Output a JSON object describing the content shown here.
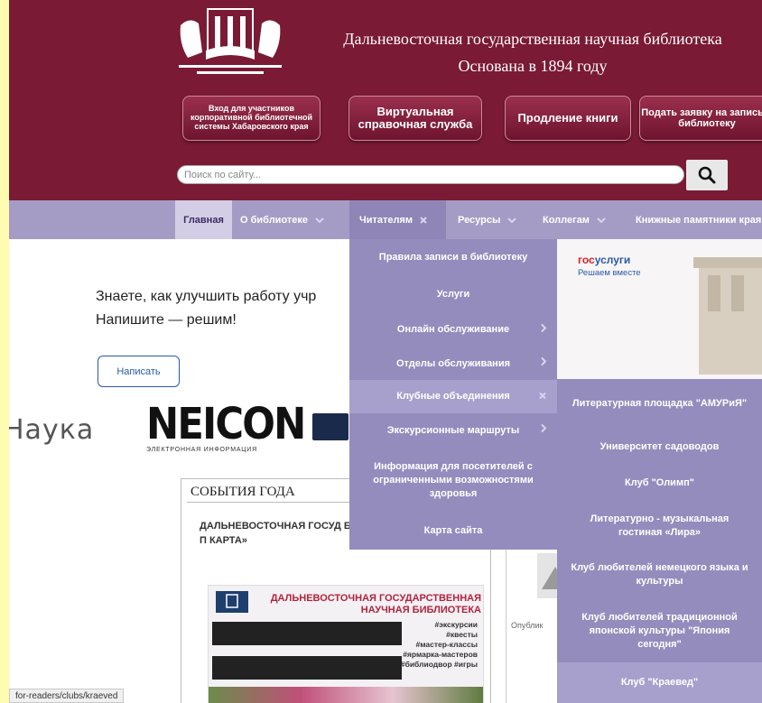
{
  "header": {
    "title_line1": "Дальневосточная государственная научная библиотека",
    "title_line2": "Основана в 1894 году",
    "buttons": {
      "members": "Вход для участников корпоративной библиотечной системы Хабаровского края",
      "virtual": "Виртуальная справочная служба",
      "renew": "Продление книги",
      "apply": "Подать заявку на запись в библиотеку"
    },
    "search_placeholder": "Поиск по сайту..."
  },
  "nav": {
    "items": [
      "Главная",
      "О библиотеке",
      "Читателям",
      "Ресурсы",
      "Коллегам",
      "Книжные памятники края"
    ]
  },
  "readers_menu": {
    "items": [
      "Правила записи в библиотеку",
      "Услуги",
      "Онлайн обслуживание",
      "Отделы обслуживания",
      "Клубные объединения",
      "Экскурсионные маршруты",
      "Информация для посетителей с ограниченными возможностями здоровья",
      "Карта сайта"
    ]
  },
  "club_submenu": {
    "items": [
      "Литературная площадка \"АМУРиЯ\"",
      "Университет садоводов",
      "Клуб \"Олимп\"",
      "Литературно - музыкальная гостиная «Лира»",
      "Клуб любителей немецкого языка и культуры",
      "Клуб любителей традиционной японской культуры \"Япония сегодня\"",
      "Клуб \"Краевед\""
    ]
  },
  "main": {
    "feedback_line1": "Знаете, как улучшить работу учр",
    "feedback_line2": "Напишите — решим!",
    "write_button": "Написать",
    "gos_logo_a": "гос",
    "gos_logo_b": "услуги",
    "gos_slogan": "Решаем вместе",
    "nauka": "Наука",
    "neicon": "NEICON",
    "neicon_sub": "ЭЛЕКТРОННАЯ ИНФОРМАЦИЯ",
    "events_title": "СОБЫТИЯ ГОДА",
    "events_text": "ДАЛЬНЕВОСТОЧНАЯ ГОСУД БИБЛИОТЕКА - УЧАСТНИК П КАРТА»",
    "banner_title": "ДАЛЬНЕВОСТОЧНАЯ ГОСУДАРСТВЕННАЯ НАУЧНАЯ БИБЛИОТЕКА",
    "banner_tags": [
      "#экскурсии",
      "#квесты",
      "#мастер-классы",
      "#ярмарка-мастеров",
      "#библиодвор #игры"
    ],
    "published": "Опублик"
  },
  "status_url": "for-readers/clubs/kraeved",
  "colors": {
    "header_bg": "#7a1a34",
    "nav_bg": "#a59cc6",
    "menu_bg": "#958cbe",
    "menu_active": "#a8a0cc",
    "accent_blue": "#2a5aa8"
  }
}
